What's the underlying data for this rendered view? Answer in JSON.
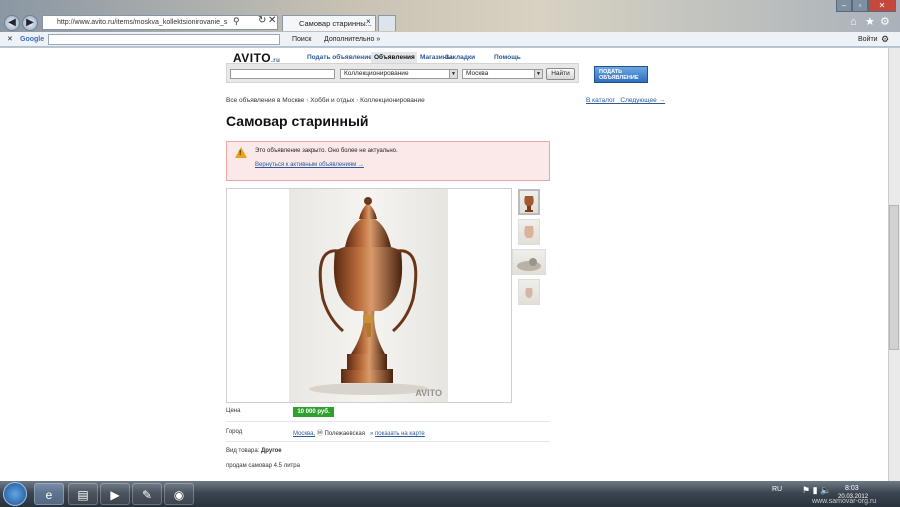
{
  "browser": {
    "url": "http://www.avito.ru/items/moskva_kollektsionirovanie_s",
    "tab_active": "Самовар старинны...",
    "toolbar": {
      "search_label": "Поиск",
      "addon_label": "Дополнительно »",
      "google_label": "Google",
      "login_label": "Войти"
    }
  },
  "site": {
    "logo": "AVITO",
    "logo_suffix": ".ru",
    "nav": [
      "Подать объявление",
      "Объявления",
      "Магазины",
      "Закладки",
      "Помощь"
    ],
    "search": {
      "query": "",
      "category": "Коллекционирование",
      "city": "Москва",
      "button": "Найти",
      "post_button_line1": "ПОДАТЬ",
      "post_button_line2": "ОБЪЯВЛЕНИЕ"
    },
    "breadcrumb": [
      "Все объявления в Москве",
      "Хобби и отдых",
      "Коллекционирование"
    ],
    "breadcrumb_right": [
      "В каталог",
      "Следующее →"
    ]
  },
  "ad": {
    "title": "Самовар старинный",
    "closed_text": "Это объявление закрыто. Оно более не актуально.",
    "closed_link": "Вернуться к активным объявлениям →",
    "watermark": "AVITO",
    "price_label": "Цена",
    "price": "10 000 руб.",
    "city_label": "Город",
    "city": "Москва,",
    "metro": "Полежаевская",
    "map_link": "показать на карте",
    "type_label": "Вид товара:",
    "type_value": "Другое",
    "description": "продам самовар 4.5 литра"
  },
  "taskbar": {
    "lang": "RU",
    "time": "8:03",
    "date": "20.03.2012",
    "watermark": "www.samovar-org.ru"
  }
}
